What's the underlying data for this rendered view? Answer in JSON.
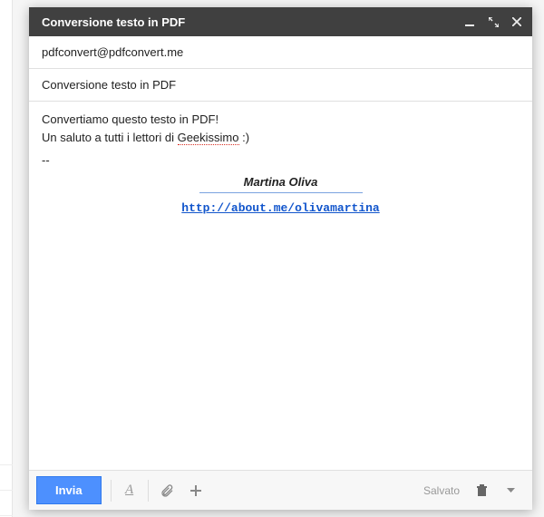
{
  "header": {
    "title": "Conversione testo in PDF"
  },
  "fields": {
    "to": "pdfconvert@pdfconvert.me",
    "subject": "Conversione testo in PDF"
  },
  "body": {
    "line1": "Convertiamo questo testo in PDF!",
    "line2_pre": "Un saluto a tutti i lettori di ",
    "line2_spellcheck": "Geekissimo",
    "line2_post": " :)",
    "separator": "--"
  },
  "signature": {
    "name": "Martina Oliva",
    "url": "http://about.me/olivamartina"
  },
  "footer": {
    "send_label": "Invia",
    "saved_label": "Salvato"
  }
}
